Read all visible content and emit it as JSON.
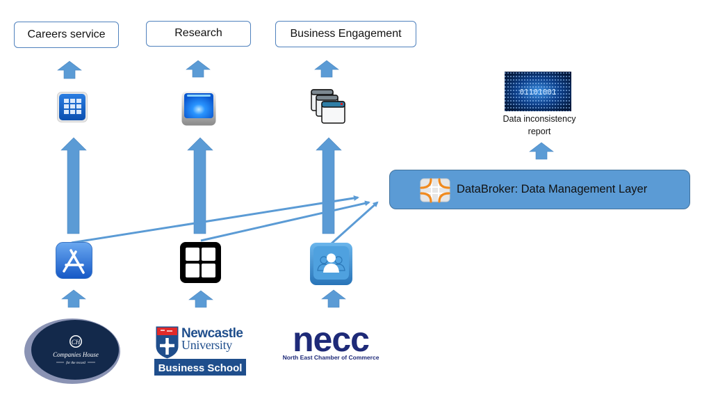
{
  "diagram": {
    "colors": {
      "arrow": "#5b9bd5",
      "box_border": "#4f81bd",
      "broker_fill": "#5b9bd5",
      "companies_house_navy": "#13294b",
      "newcastle_blue": "#1f4e8c",
      "necc_navy": "#1e2a78",
      "accent_orange": "#f08a1e"
    },
    "services": [
      {
        "label": "Careers service",
        "icon": "grid-app-icon"
      },
      {
        "label": "Research",
        "icon": "drive-icon"
      },
      {
        "label": "Business Engagement",
        "icon": "stacked-windows-icon"
      }
    ],
    "source_apps": [
      {
        "icon": "app-store-icon"
      },
      {
        "icon": "windows-tiles-icon"
      },
      {
        "icon": "user-group-icon"
      }
    ],
    "sources": [
      {
        "name": "Companies House",
        "tagline": "for the record",
        "monogram": "CH"
      },
      {
        "name_line1": "Newcastle",
        "name_line2": "University",
        "banner": "Business School"
      },
      {
        "wordmark": "necc",
        "subtitle": "North East Chamber of Commerce"
      }
    ],
    "broker": {
      "label": "DataBroker: Data Management Layer",
      "icon": "databroker-icon"
    },
    "report": {
      "caption": "Data inconsistency report",
      "caption_line1": "Data inconsistency",
      "caption_line2": "report",
      "image": "binary-code-image",
      "binary_text": "01101001"
    }
  }
}
